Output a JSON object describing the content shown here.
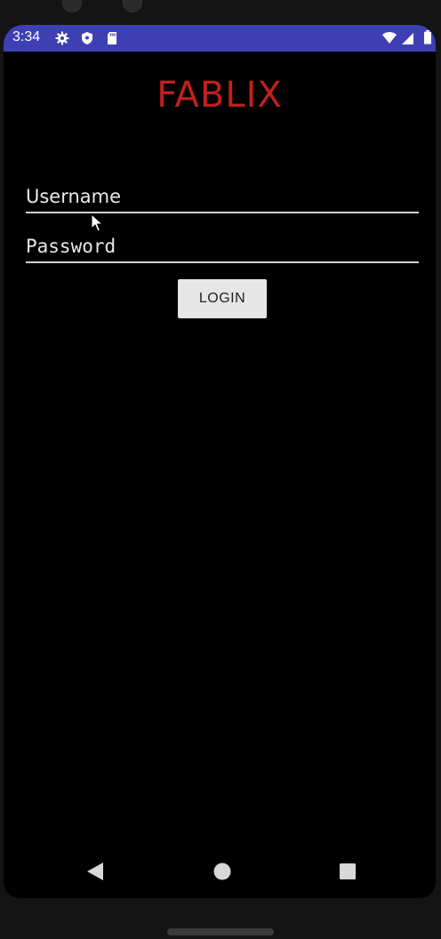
{
  "status_bar": {
    "time": "3:34",
    "icons": [
      "gear-icon",
      "shield-icon",
      "sd-card-icon",
      "wifi-icon",
      "signal-icon",
      "battery-icon"
    ],
    "background_color": "#3f3fb4"
  },
  "app": {
    "title": "FABLIX",
    "title_color": "#c0201e"
  },
  "login_form": {
    "username_placeholder": "Username",
    "username_value": "",
    "password_placeholder": "Password",
    "password_value": "",
    "login_label": "LOGIN"
  },
  "nav_bar": {
    "icons": [
      "back-icon",
      "home-icon",
      "recents-icon"
    ]
  }
}
